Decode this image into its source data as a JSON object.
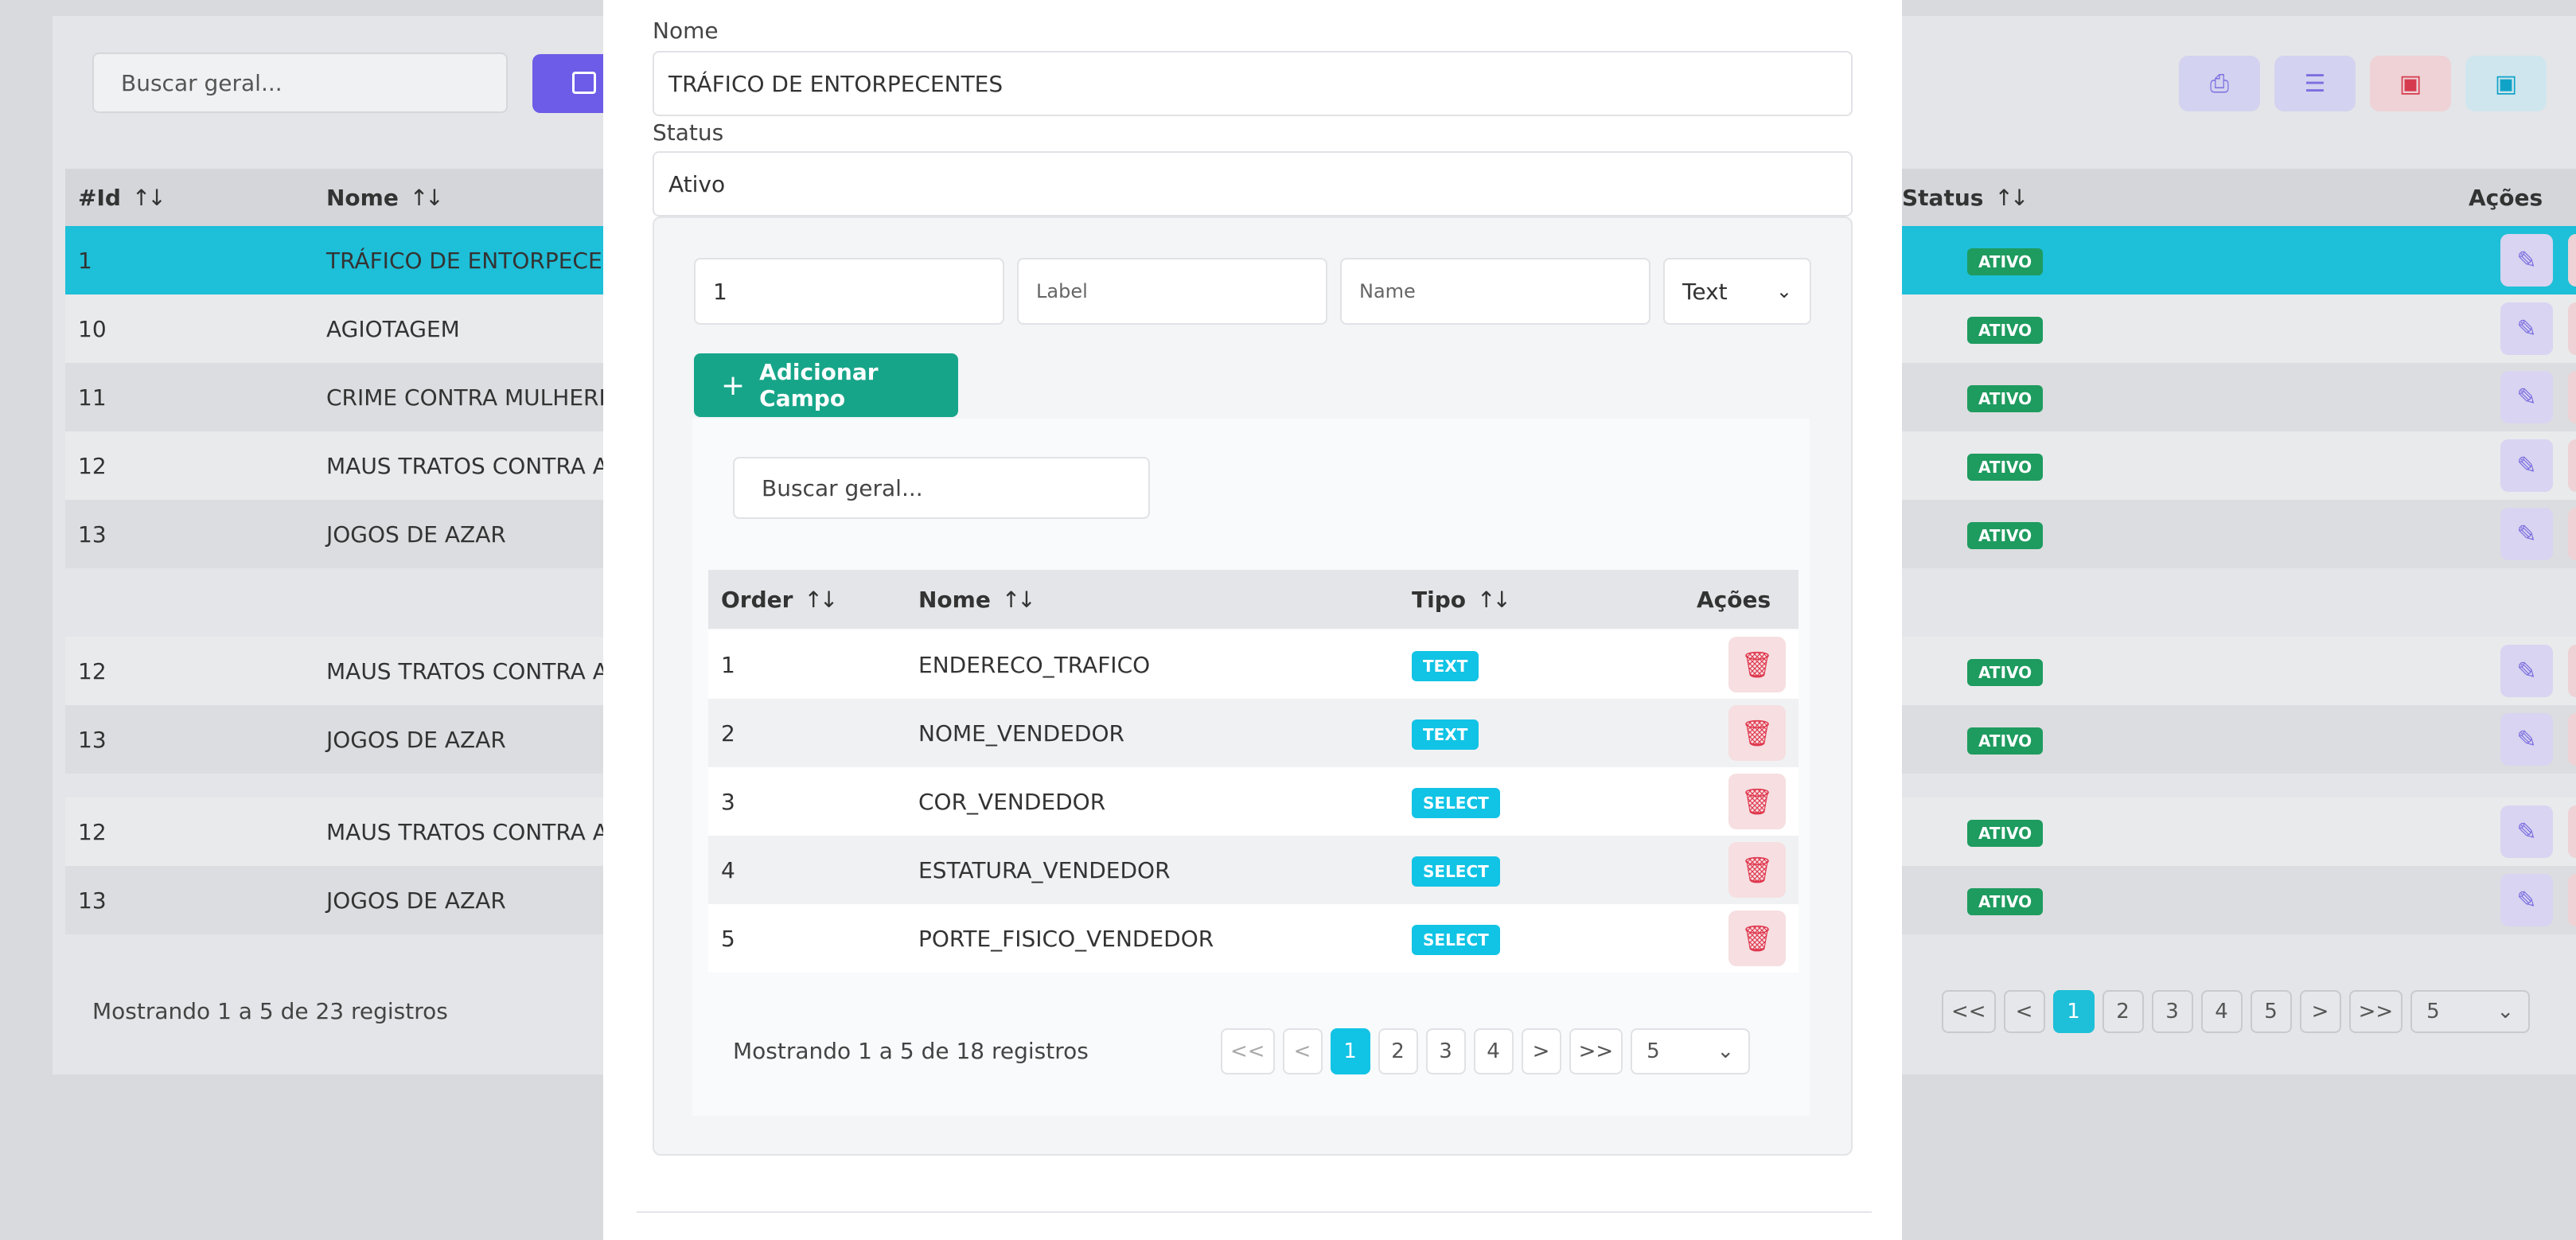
{
  "background": {
    "search_placeholder": "Buscar geral...",
    "columns": {
      "id": "#Id",
      "nome": "Nome",
      "status": "Status",
      "acoes": "Ações"
    },
    "sort_glyph": "↑↓",
    "rows": [
      {
        "id": "1",
        "nome": "TRÁFICO DE ENTORPECEN",
        "status": "ATIVO"
      },
      {
        "id": "10",
        "nome": "AGIOTAGEM",
        "status": "ATIVO"
      },
      {
        "id": "11",
        "nome": "CRIME CONTRA MULHERES",
        "status": "ATIVO"
      },
      {
        "id": "12",
        "nome": "MAUS TRATOS CONTRA AN",
        "status": "ATIVO"
      },
      {
        "id": "13",
        "nome": "JOGOS DE AZAR",
        "status": "ATIVO"
      },
      {
        "id": "12",
        "nome": "MAUS TRATOS CONTRA AN",
        "status": "ATIVO"
      },
      {
        "id": "13",
        "nome": "JOGOS DE AZAR",
        "status": "ATIVO"
      },
      {
        "id": "12",
        "nome": "MAUS TRATOS CONTRA AN",
        "status": "ATIVO"
      },
      {
        "id": "13",
        "nome": "JOGOS DE AZAR",
        "status": "ATIVO"
      }
    ],
    "footer": "Mostrando 1 a 5 de 23 registros",
    "pager": [
      "<<",
      "<",
      "1",
      "2",
      "3",
      "4",
      "5",
      ">",
      ">>"
    ],
    "page_size": "5"
  },
  "modal": {
    "nome_label": "Nome",
    "nome_value": "TRÁFICO DE ENTORPECENTES",
    "status_label": "Status",
    "status_value": "Ativo",
    "new_field": {
      "order_value": "1",
      "label_placeholder": "Label",
      "name_placeholder": "Name",
      "type_value": "Text"
    },
    "add_button": "Adicionar Campo",
    "search_placeholder": "Buscar geral...",
    "columns": {
      "order": "Order",
      "nome": "Nome",
      "tipo": "Tipo",
      "acoes": "Ações"
    },
    "fields": [
      {
        "order": "1",
        "nome": "ENDERECO_TRAFICO",
        "tipo": "TEXT"
      },
      {
        "order": "2",
        "nome": "NOME_VENDEDOR",
        "tipo": "TEXT"
      },
      {
        "order": "3",
        "nome": "COR_VENDEDOR",
        "tipo": "SELECT"
      },
      {
        "order": "4",
        "nome": "ESTATURA_VENDEDOR",
        "tipo": "SELECT"
      },
      {
        "order": "5",
        "nome": "PORTE_FISICO_VENDEDOR",
        "tipo": "SELECT"
      }
    ],
    "footer": "Mostrando 1 a 5 de 18 registros",
    "pager": [
      "<<",
      "<",
      "1",
      "2",
      "3",
      "4",
      ">",
      ">>"
    ],
    "page_size": "5"
  },
  "colors": {
    "accent_cyan": "#1ebfd8",
    "primary_purple": "#6c5ce7",
    "success_green": "#17a589",
    "danger_red": "#e0384e"
  }
}
